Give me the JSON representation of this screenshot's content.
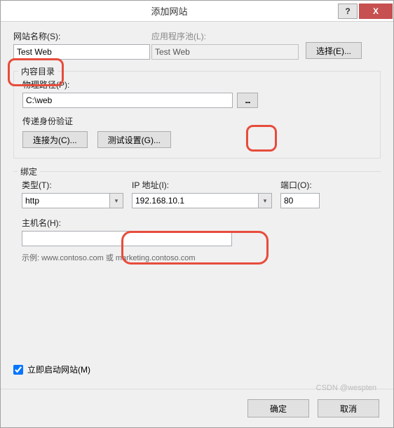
{
  "titlebar": {
    "title": "添加网站",
    "help": "?",
    "close": "X"
  },
  "site": {
    "name_label": "网站名称(S):",
    "name_value": "Test Web",
    "pool_label": "应用程序池(L):",
    "pool_value": "Test Web",
    "select_btn": "选择(E)..."
  },
  "content_dir": {
    "legend": "内容目录",
    "path_label": "物理路径(P):",
    "path_value": "C:\\web",
    "browse": "...",
    "auth_label": "传递身份验证",
    "connect_as": "连接为(C)...",
    "test_settings": "测试设置(G)..."
  },
  "binding": {
    "legend": "绑定",
    "type_label": "类型(T):",
    "type_value": "http",
    "ip_label": "IP 地址(I):",
    "ip_value": "192.168.10.1",
    "port_label": "端口(O):",
    "port_value": "80",
    "host_label": "主机名(H):",
    "host_value": "",
    "example": "示例: www.contoso.com 或 marketing.contoso.com"
  },
  "start_now": "立即启动网站(M)",
  "footer": {
    "ok": "确定",
    "cancel": "取消"
  },
  "watermark": "CSDN @wespten"
}
